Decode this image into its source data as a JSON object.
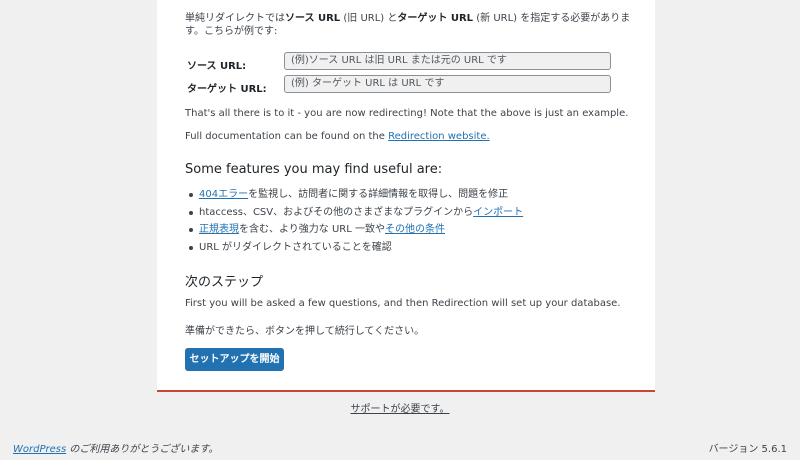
{
  "intro": {
    "part1": "単純リダイレクトでは",
    "bold1": "ソース URL",
    "part2": " (旧 URL) と",
    "bold2": "ターゲット URL",
    "part3": " (新 URL) を指定する必要があります。こちらが例です:"
  },
  "fields": {
    "source_label": "ソース URL:",
    "source_value": "(例)ソース URL は旧 URL または元の URL です",
    "target_label": "ターゲット URL:",
    "target_value": "(例) ターゲット URL は URL です"
  },
  "notes": {
    "redirecting": "That's all there is to it - you are now redirecting! Note that the above is just an example.",
    "docs_prefix": "Full documentation can be found on the ",
    "docs_link": "Redirection website.",
    "docs_suffix": ""
  },
  "features": {
    "heading": "Some features you may find useful are:",
    "item1_link": "404エラー",
    "item1_text": "を監視し、訪問者に関する詳細情報を取得し、問題を修正",
    "item2_text": "htaccess、CSV、およびその他のさまざまなプラグインから",
    "item2_link": "インポート",
    "item3_link1": "正規表現",
    "item3_text": "を含む、より強力な URL 一致や",
    "item3_link2": "その他の条件",
    "item4_text": "URL がリダイレクトされていることを確認"
  },
  "next": {
    "heading": "次のステップ",
    "line1": "First you will be asked a few questions, and then Redirection will set up your database.",
    "line2": "準備ができたら、ボタンを押して続行してください。",
    "button": "セットアップを開始"
  },
  "support": "サポートが必要です。",
  "footer": {
    "wp_link": "WordPress",
    "thanks": " のご利用ありがとうございます。",
    "version": "バージョン 5.6.1"
  },
  "colors": {
    "accent": "#2271b1",
    "divider": "#c9473a",
    "background": "#f0f0f1"
  }
}
